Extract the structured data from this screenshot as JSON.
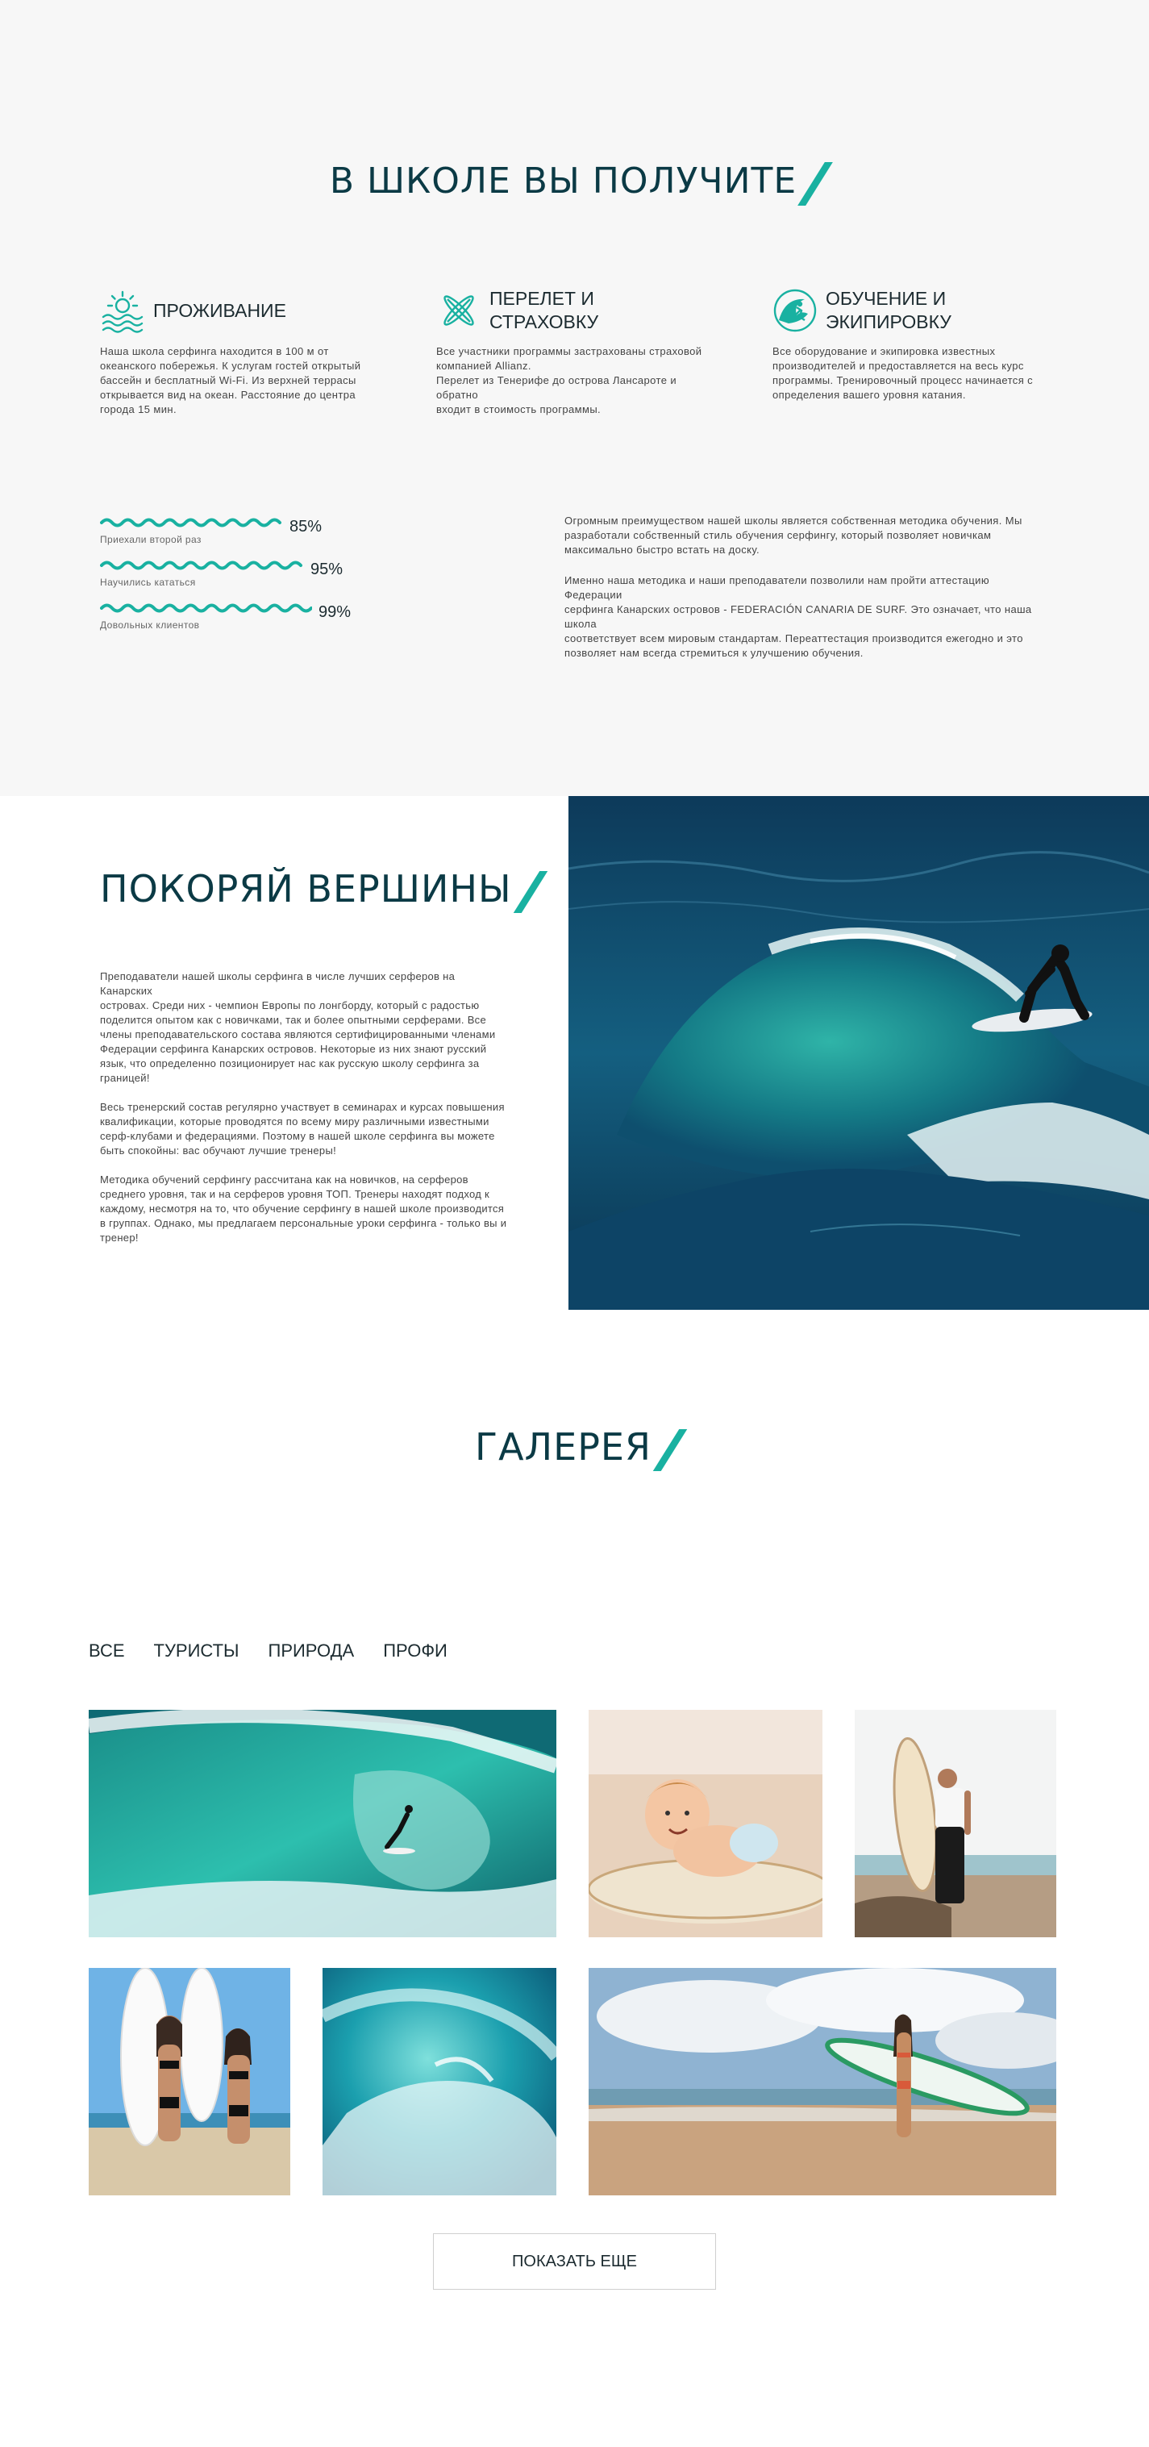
{
  "colors": {
    "accent": "#19b1a1",
    "heading": "#0b3a45",
    "section_bg": "#f7f7f7"
  },
  "benefits": {
    "title": "В ШКОЛЕ ВЫ ПОЛУЧИТЕ",
    "features": [
      {
        "icon": "sun-waves-icon",
        "title_lines": [
          "ПРОЖИВАНИЕ"
        ],
        "text_lines": [
          "Наша школа серфинга находится в 100 м от",
          "океанского побережья. К услугам гостей открытый",
          "бассейн и бесплатный Wi-Fi. Из верхней террасы",
          "открывается вид на океан. Расстояние до центра",
          "города 15 мин."
        ]
      },
      {
        "icon": "crossed-surfboards-icon",
        "title_lines": [
          "ПЕРЕЛЕТ И",
          "СТРАХОВКУ"
        ],
        "text_lines": [
          "Все участники программы застрахованы страховой",
          "компанией Allianz.",
          "Перелет из Тенерифе до острова Лансароте и обратно",
          "входит в стоимость программы."
        ]
      },
      {
        "icon": "surfer-wave-icon",
        "title_lines": [
          "ОБУЧЕНИЕ И",
          "ЭКИПИРОВКУ"
        ],
        "text_lines": [
          "Все оборудование и экипировка известных",
          "производителей и предоставляется на весь курс",
          "программы. Тренировочный процесс начинается с",
          "определения вашего уровня катания."
        ]
      }
    ],
    "stats": [
      {
        "value": 85,
        "label_value": "85%",
        "label": "Приехали второй раз"
      },
      {
        "value": 95,
        "label_value": "95%",
        "label": "Научились кататься"
      },
      {
        "value": 99,
        "label_value": "99%",
        "label": "Довольных клиентов"
      }
    ],
    "advantages": [
      {
        "lines": [
          "Огромным преимуществом нашей школы является собственная методика обучения. Мы",
          "разработали собственный стиль обучения серфингу, который позволяет новичкам",
          "максимально быстро встать на доску."
        ]
      },
      {
        "lines": [
          "Именно наша методика и наши преподаватели позволили нам пройти аттестацию Федерации",
          "серфинга Канарских островов - FEDERACIÓN CANARIA DE SURF. Это означает, что наша школа",
          "соответствует всем мировым стандартам. Переаттестация производится ежегодно и это",
          "позволяет нам всегда стремиться к улучшению обучения."
        ]
      }
    ]
  },
  "coaches": {
    "title": "ПОКОРЯЙ ВЕРШИНЫ",
    "paragraphs": [
      {
        "lines": [
          "Преподаватели нашей школы серфинга в числе лучших серферов на Канарских",
          "островах. Среди них - чемпион Европы по лонгборду, который с радостью",
          "поделится опытом как с новичками, так и более опытными серферами. Все",
          "члены преподавательского состава являются сертифицированными членами",
          "Федерации серфинга Канарских островов. Некоторые из них знают русский",
          "язык, что определенно позиционирует нас как русскую школу серфинга за",
          "границей!"
        ]
      },
      {
        "lines": [
          "Весь тренерский состав регулярно участвует в семинарах и курсах повышения",
          "квалификации, которые проводятся по всему миру различными известными",
          "серф-клубами и федерациями. Поэтому в нашей школе серфинга вы можете",
          "быть спокойны: вас обучают лучшие тренеры!"
        ]
      },
      {
        "lines": [
          "Методика обучений серфингу рассчитана как на новичков, на серферов",
          "среднего уровня, так и на серферов уровня ТОП. Тренеры находят подход к",
          "каждому, несмотря на то, что обучение серфингу в нашей школе производится",
          "в группах. Однако, мы предлагаем персональные уроки серфинга - только вы и",
          "тренер!"
        ]
      }
    ]
  },
  "gallery": {
    "title": "ГАЛЕРЕЯ",
    "filters": [
      "ВСЕ",
      "ТУРИСТЫ",
      "ПРИРОДА",
      "ПРОФИ"
    ],
    "more_button": "ПОКАЗАТЬ ЕЩЕ"
  }
}
